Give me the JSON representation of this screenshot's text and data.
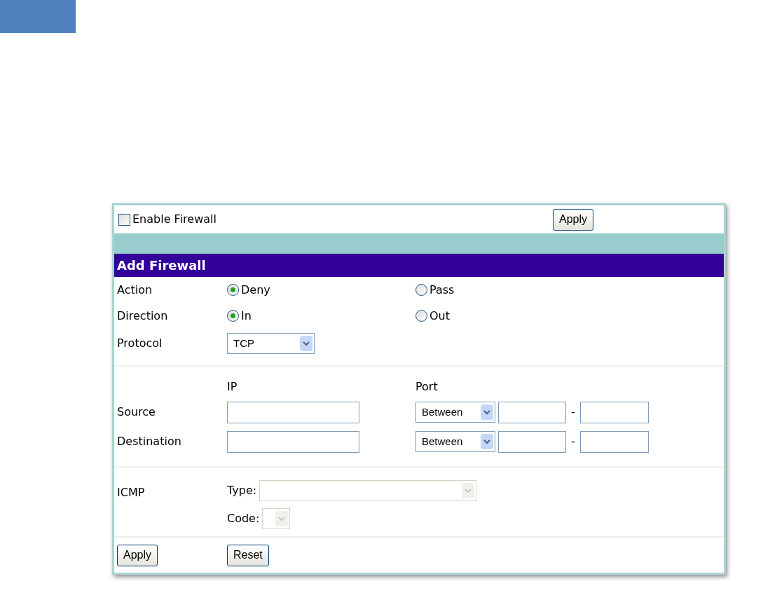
{
  "enable_firewall": {
    "label": "Enable Firewall",
    "checked": false,
    "apply": "Apply"
  },
  "section": {
    "title": "Add Firewall"
  },
  "radio_rows": [
    {
      "label": "Action",
      "options": [
        {
          "label": "Deny",
          "selected": true
        },
        {
          "label": "Pass",
          "selected": false
        }
      ]
    },
    {
      "label": "Direction",
      "options": [
        {
          "label": "In",
          "selected": true
        },
        {
          "label": "Out",
          "selected": false
        }
      ]
    }
  ],
  "protocol": {
    "label": "Protocol",
    "value": "TCP"
  },
  "address": {
    "ip_heading": "IP",
    "port_heading": "Port",
    "separator": "-",
    "rows": [
      {
        "label": "Source",
        "port_mode": "Between"
      },
      {
        "label": "Destination",
        "port_mode": "Between"
      }
    ]
  },
  "icmp": {
    "label": "ICMP",
    "type_label": "Type:",
    "code_label": "Code:",
    "disabled": true
  },
  "buttons": [
    "Apply",
    "Reset"
  ]
}
